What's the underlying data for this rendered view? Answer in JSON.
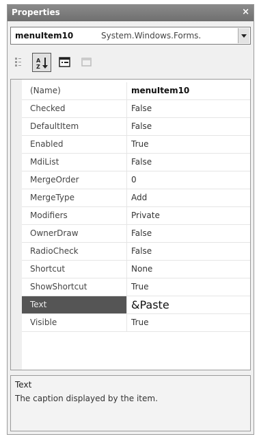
{
  "window": {
    "title": "Properties",
    "close_glyph": "×"
  },
  "object_selector": {
    "name": "menuItem10",
    "type": "System.Windows.Forms."
  },
  "toolbar": {
    "icons": [
      "categorized-icon",
      "alphabetical-icon",
      "property-pages-icon",
      "events-icon"
    ]
  },
  "properties": [
    {
      "name": "(Name)",
      "value": "menuItem10"
    },
    {
      "name": "Checked",
      "value": "False"
    },
    {
      "name": "DefaultItem",
      "value": "False"
    },
    {
      "name": "Enabled",
      "value": "True"
    },
    {
      "name": "MdiList",
      "value": "False"
    },
    {
      "name": "MergeOrder",
      "value": "0"
    },
    {
      "name": "MergeType",
      "value": "Add"
    },
    {
      "name": "Modifiers",
      "value": "Private"
    },
    {
      "name": "OwnerDraw",
      "value": "False"
    },
    {
      "name": "RadioCheck",
      "value": "False"
    },
    {
      "name": "Shortcut",
      "value": "None"
    },
    {
      "name": "ShowShortcut",
      "value": "True"
    },
    {
      "name": "Text",
      "value": "&Paste"
    },
    {
      "name": "Visible",
      "value": "True"
    }
  ],
  "description": {
    "title": "Text",
    "text": "The caption displayed by the item."
  }
}
